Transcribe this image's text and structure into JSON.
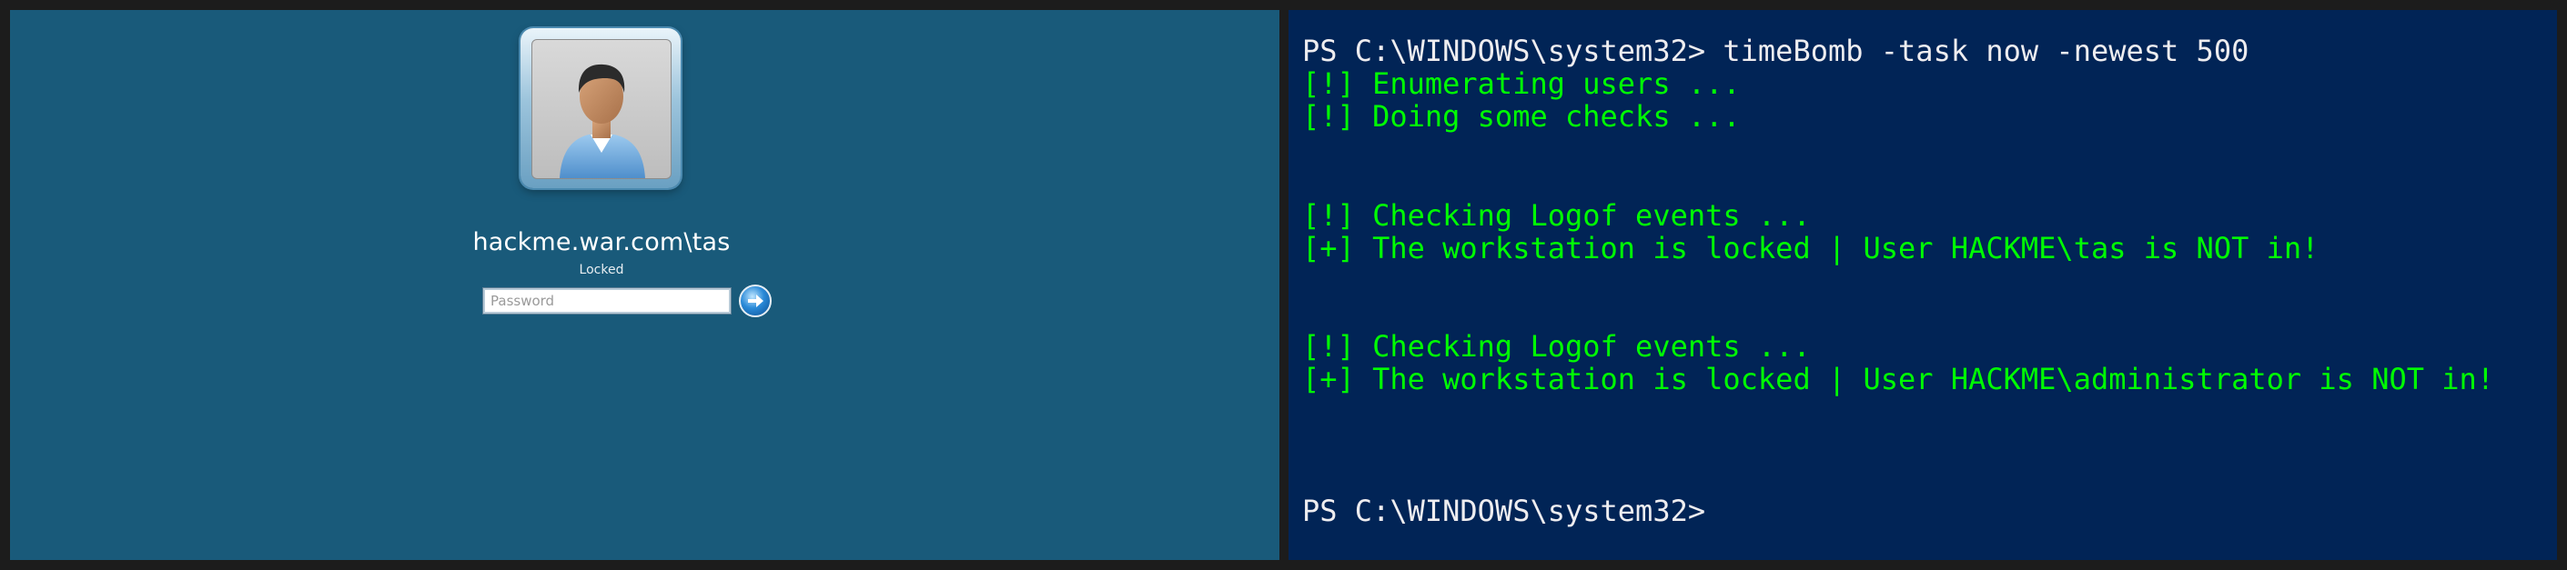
{
  "lock_screen": {
    "username": "hackme.war.com\\tas",
    "status": "Locked",
    "password_placeholder": "Password",
    "avatar": "user-avatar",
    "submit_icon": "arrow-right-icon"
  },
  "console": {
    "lines": [
      {
        "text": "PS C:\\WINDOWS\\system32> timeBomb -task now -newest 500",
        "kind": "prompt"
      },
      {
        "text": "[!] Enumerating users ...",
        "kind": "info"
      },
      {
        "text": "[!] Doing some checks ...",
        "kind": "info"
      },
      {
        "text": "[!] Checking Logof events ...",
        "kind": "info"
      },
      {
        "text": "[+] The workstation is locked | User HACKME\\tas is NOT in!",
        "kind": "info"
      },
      {
        "text": "[!] Checking Logof events ...",
        "kind": "info"
      },
      {
        "text": "[+] The workstation is locked | User HACKME\\administrator is NOT in!",
        "kind": "info"
      },
      {
        "text": "PS C:\\WINDOWS\\system32>",
        "kind": "prompt"
      }
    ]
  },
  "colors": {
    "lock_background": "#195a7a",
    "console_background": "#012456",
    "console_prompt": "#eeedf0",
    "console_output": "#00ff00",
    "bezel": "#1c1c1c"
  }
}
